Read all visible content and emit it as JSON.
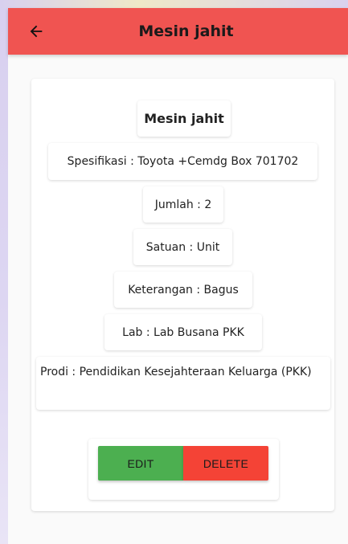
{
  "appbar": {
    "title": "Mesin jahit",
    "back_icon": "arrow-left-icon",
    "color": "#f05451"
  },
  "detail": {
    "name": "Mesin jahit",
    "spesifikasi": "Spesifikasi : Toyota +Cemdg Box 701702",
    "jumlah": "Jumlah : 2",
    "satuan": "Satuan : Unit",
    "keterangan": "Keterangan : Bagus",
    "lab": "Lab : Lab Busana PKK",
    "prodi": "Prodi : Pendidikan Kesejahteraan Keluarga (PKK)"
  },
  "actions": {
    "edit_label": "EDIT",
    "delete_label": "DELETE",
    "edit_color": "#4caf50",
    "delete_color": "#f44336"
  }
}
